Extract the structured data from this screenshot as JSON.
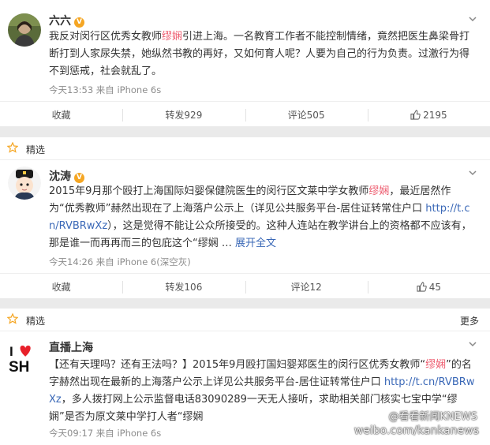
{
  "posts": [
    {
      "author": "六六",
      "text_parts": [
        {
          "t": "我反对闵行区优秀女教师",
          "c": ""
        },
        {
          "t": "缪娴",
          "c": "hl"
        },
        {
          "t": "引进上海。一名教育工作者不能控制情绪，竟然把医生鼻梁骨打断打到人家尿失禁，她纵然书教的再好，又如何育人呢？人要为自己的行为负责。过激行为得不到惩戒，社会就乱了。",
          "c": ""
        }
      ],
      "meta": "今天13:53 来自 iPhone 6s",
      "actions": {
        "collect": "收藏",
        "repost": "转发929",
        "comment": "评论505",
        "like": "2195"
      }
    },
    {
      "tag": "精选",
      "author": "沈涛",
      "text_parts": [
        {
          "t": "2015年9月那个殴打上海国际妇婴保健院医生的闵行区文莱中学女教师",
          "c": ""
        },
        {
          "t": "缪娴",
          "c": "hl"
        },
        {
          "t": "，最近居然作为“优秀教师”赫然出现在了上海落户公示上（详见公共服务平台-居住证转常住户口 ",
          "c": ""
        },
        {
          "t": "http://t.cn/RVBRwXz",
          "c": "lk"
        },
        {
          "t": "），这是觉得不能让公众所接受的。这种人连站在教学讲台上的资格都不应该有，那是谁一而再再而三的包庇这个“缪娴 … ",
          "c": ""
        },
        {
          "t": "展开全文",
          "c": "lk"
        }
      ],
      "meta": "今天14:26 来自 iPhone 6(深空灰)",
      "actions": {
        "collect": "收藏",
        "repost": "转发106",
        "comment": "评论12",
        "like": "45"
      }
    },
    {
      "tag": "精选",
      "more": "更多",
      "author": "直播上海",
      "text_parts": [
        {
          "t": "【还有天理吗？还有王法吗？】2015年9月殴打国妇婴郑医生的闵行区优秀女教师“",
          "c": ""
        },
        {
          "t": "缪娴",
          "c": "hl"
        },
        {
          "t": "”的名字赫然出现在最新的上海落户公示上详见公共服务平台-居住证转常住户口 ",
          "c": ""
        },
        {
          "t": "http://t.cn/RVBRwXz",
          "c": "lk"
        },
        {
          "t": "，多人拨打网上公示监督电话83090289一天无人接听，求助相关部门核实七宝中学“缪娴”是否为原文莱中学打人者“缪娴",
          "c": ""
        }
      ],
      "meta": "今天09:17 来自 iPhone 6s",
      "logo_text": "I♥SH"
    }
  ],
  "watermark": {
    "line1": "@看看新闻KNEWS",
    "line2": "weibo.com/kankanews"
  },
  "colors": {
    "highlight": "#ed5b6e",
    "link": "#3a68b7",
    "badge": "#f5a623",
    "tag_star": "#f5a623"
  }
}
